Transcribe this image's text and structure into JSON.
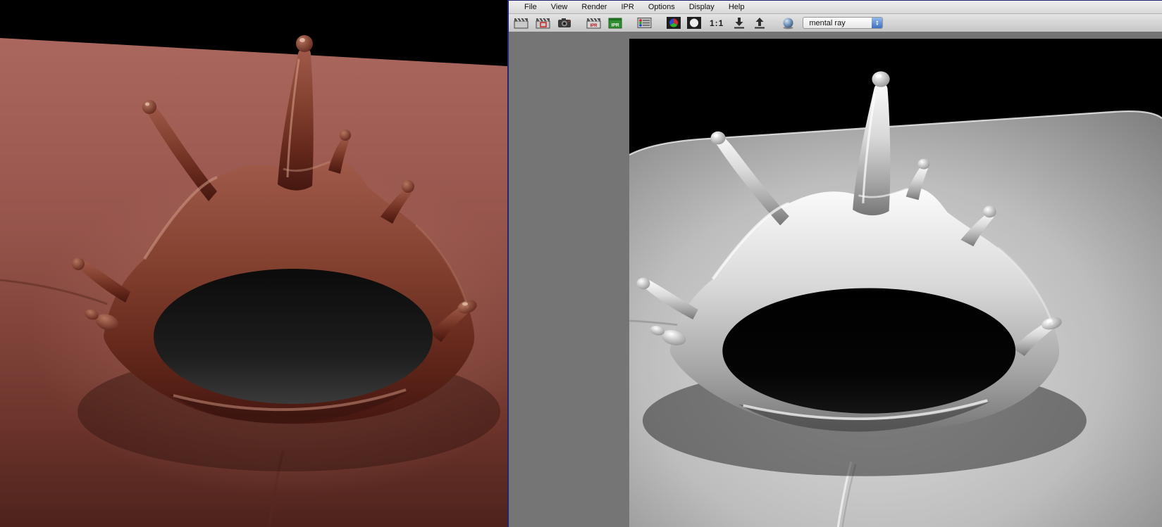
{
  "render_view": {
    "menu": [
      "File",
      "View",
      "Render",
      "IPR",
      "Options",
      "Display",
      "Help"
    ],
    "toolbar": {
      "zoom_one_to_one": "1:1",
      "renderer": "mental ray",
      "ipr_label": "IPR",
      "icons": [
        {
          "name": "redo-previous-render-icon",
          "glyph": "clapperboard"
        },
        {
          "name": "render-region-icon",
          "glyph": "clapperboard-red-region"
        },
        {
          "name": "snapshot-icon",
          "glyph": "camera"
        },
        {
          "name": "ipr-render-icon",
          "glyph": "clapperboard-ipr"
        },
        {
          "name": "refresh-ipr-region-icon",
          "glyph": "green-ipr-badge"
        },
        {
          "name": "render-settings-icon",
          "glyph": "rgb-dots-sliders"
        },
        {
          "name": "rgb-channels-icon",
          "glyph": "rgb-color-wheel"
        },
        {
          "name": "alpha-channel-icon",
          "glyph": "white-circle-on-black"
        },
        {
          "name": "keep-image-icon",
          "glyph": "arrow-down-into-tray"
        },
        {
          "name": "remove-image-icon",
          "glyph": "arrow-up-from-tray"
        },
        {
          "name": "render-globals-sphere-icon",
          "glyph": "shaded-sphere"
        }
      ]
    },
    "canvas": {
      "content": "grayscale crown liquid splash render on glossy gray tabletop"
    }
  },
  "left_viewport": {
    "content": "shaded crown liquid splash on reddish-brown surface"
  },
  "colors": {
    "splash_brown": "#7c3a2e",
    "floor_brown": "#95544b",
    "render_gray": "#c0c0c0",
    "aqua_accent": "#4272c0",
    "window_border": "#23236e",
    "gutter_gray": "#757575"
  }
}
